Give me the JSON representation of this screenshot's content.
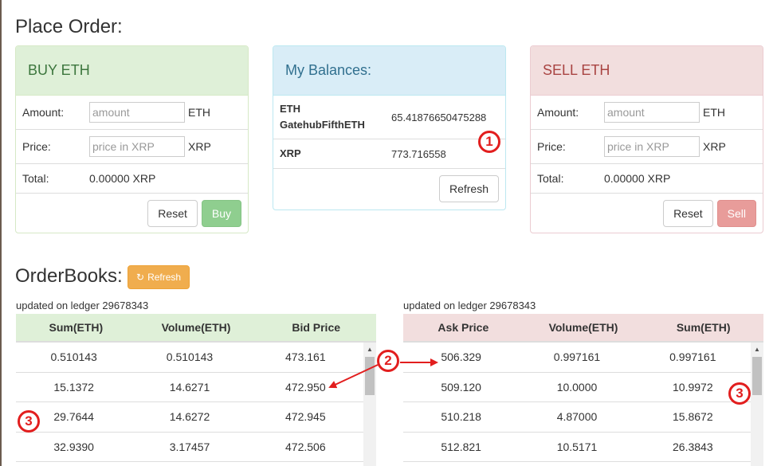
{
  "place_order": {
    "title": "Place Order:",
    "buy": {
      "heading": "BUY ETH",
      "amount_label": "Amount:",
      "amount_placeholder": "amount",
      "amount_unit": "ETH",
      "price_label": "Price:",
      "price_placeholder": "price in XRP",
      "price_unit": "XRP",
      "total_label": "Total:",
      "total_value": "0.00000 XRP",
      "reset_label": "Reset",
      "submit_label": "Buy"
    },
    "balances": {
      "heading": "My Balances:",
      "rows": [
        {
          "currency_line1": "ETH",
          "currency_line2": "GatehubFifthETH",
          "amount": "65.41876650475288"
        },
        {
          "currency_line1": "XRP",
          "currency_line2": "",
          "amount": "773.716558"
        }
      ],
      "refresh_label": "Refresh"
    },
    "sell": {
      "heading": "SELL ETH",
      "amount_label": "Amount:",
      "amount_placeholder": "amount",
      "amount_unit": "ETH",
      "price_label": "Price:",
      "price_placeholder": "price in XRP",
      "price_unit": "XRP",
      "total_label": "Total:",
      "total_value": "0.00000 XRP",
      "reset_label": "Reset",
      "submit_label": "Sell"
    }
  },
  "orderbooks": {
    "title": "OrderBooks:",
    "refresh_label": "Refresh",
    "bids": {
      "updated": "updated on ledger 29678343",
      "headers": [
        "Sum(ETH)",
        "Volume(ETH)",
        "Bid Price"
      ],
      "rows": [
        [
          "0.510143",
          "0.510143",
          "473.161"
        ],
        [
          "15.1372",
          "14.6271",
          "472.950"
        ],
        [
          "29.7644",
          "14.6272",
          "472.945"
        ],
        [
          "32.9390",
          "3.17457",
          "472.506"
        ]
      ]
    },
    "asks": {
      "updated": "updated on ledger 29678343",
      "headers": [
        "Ask Price",
        "Volume(ETH)",
        "Sum(ETH)"
      ],
      "rows": [
        [
          "506.329",
          "0.997161",
          "0.997161"
        ],
        [
          "509.120",
          "10.0000",
          "10.9972"
        ],
        [
          "510.218",
          "4.87000",
          "15.8672"
        ],
        [
          "512.821",
          "10.5171",
          "26.3843"
        ]
      ]
    }
  },
  "annotations": {
    "m1": "1",
    "m2": "2",
    "m3a": "3",
    "m3b": "3"
  },
  "colors": {
    "marker": "#e21e1e"
  }
}
